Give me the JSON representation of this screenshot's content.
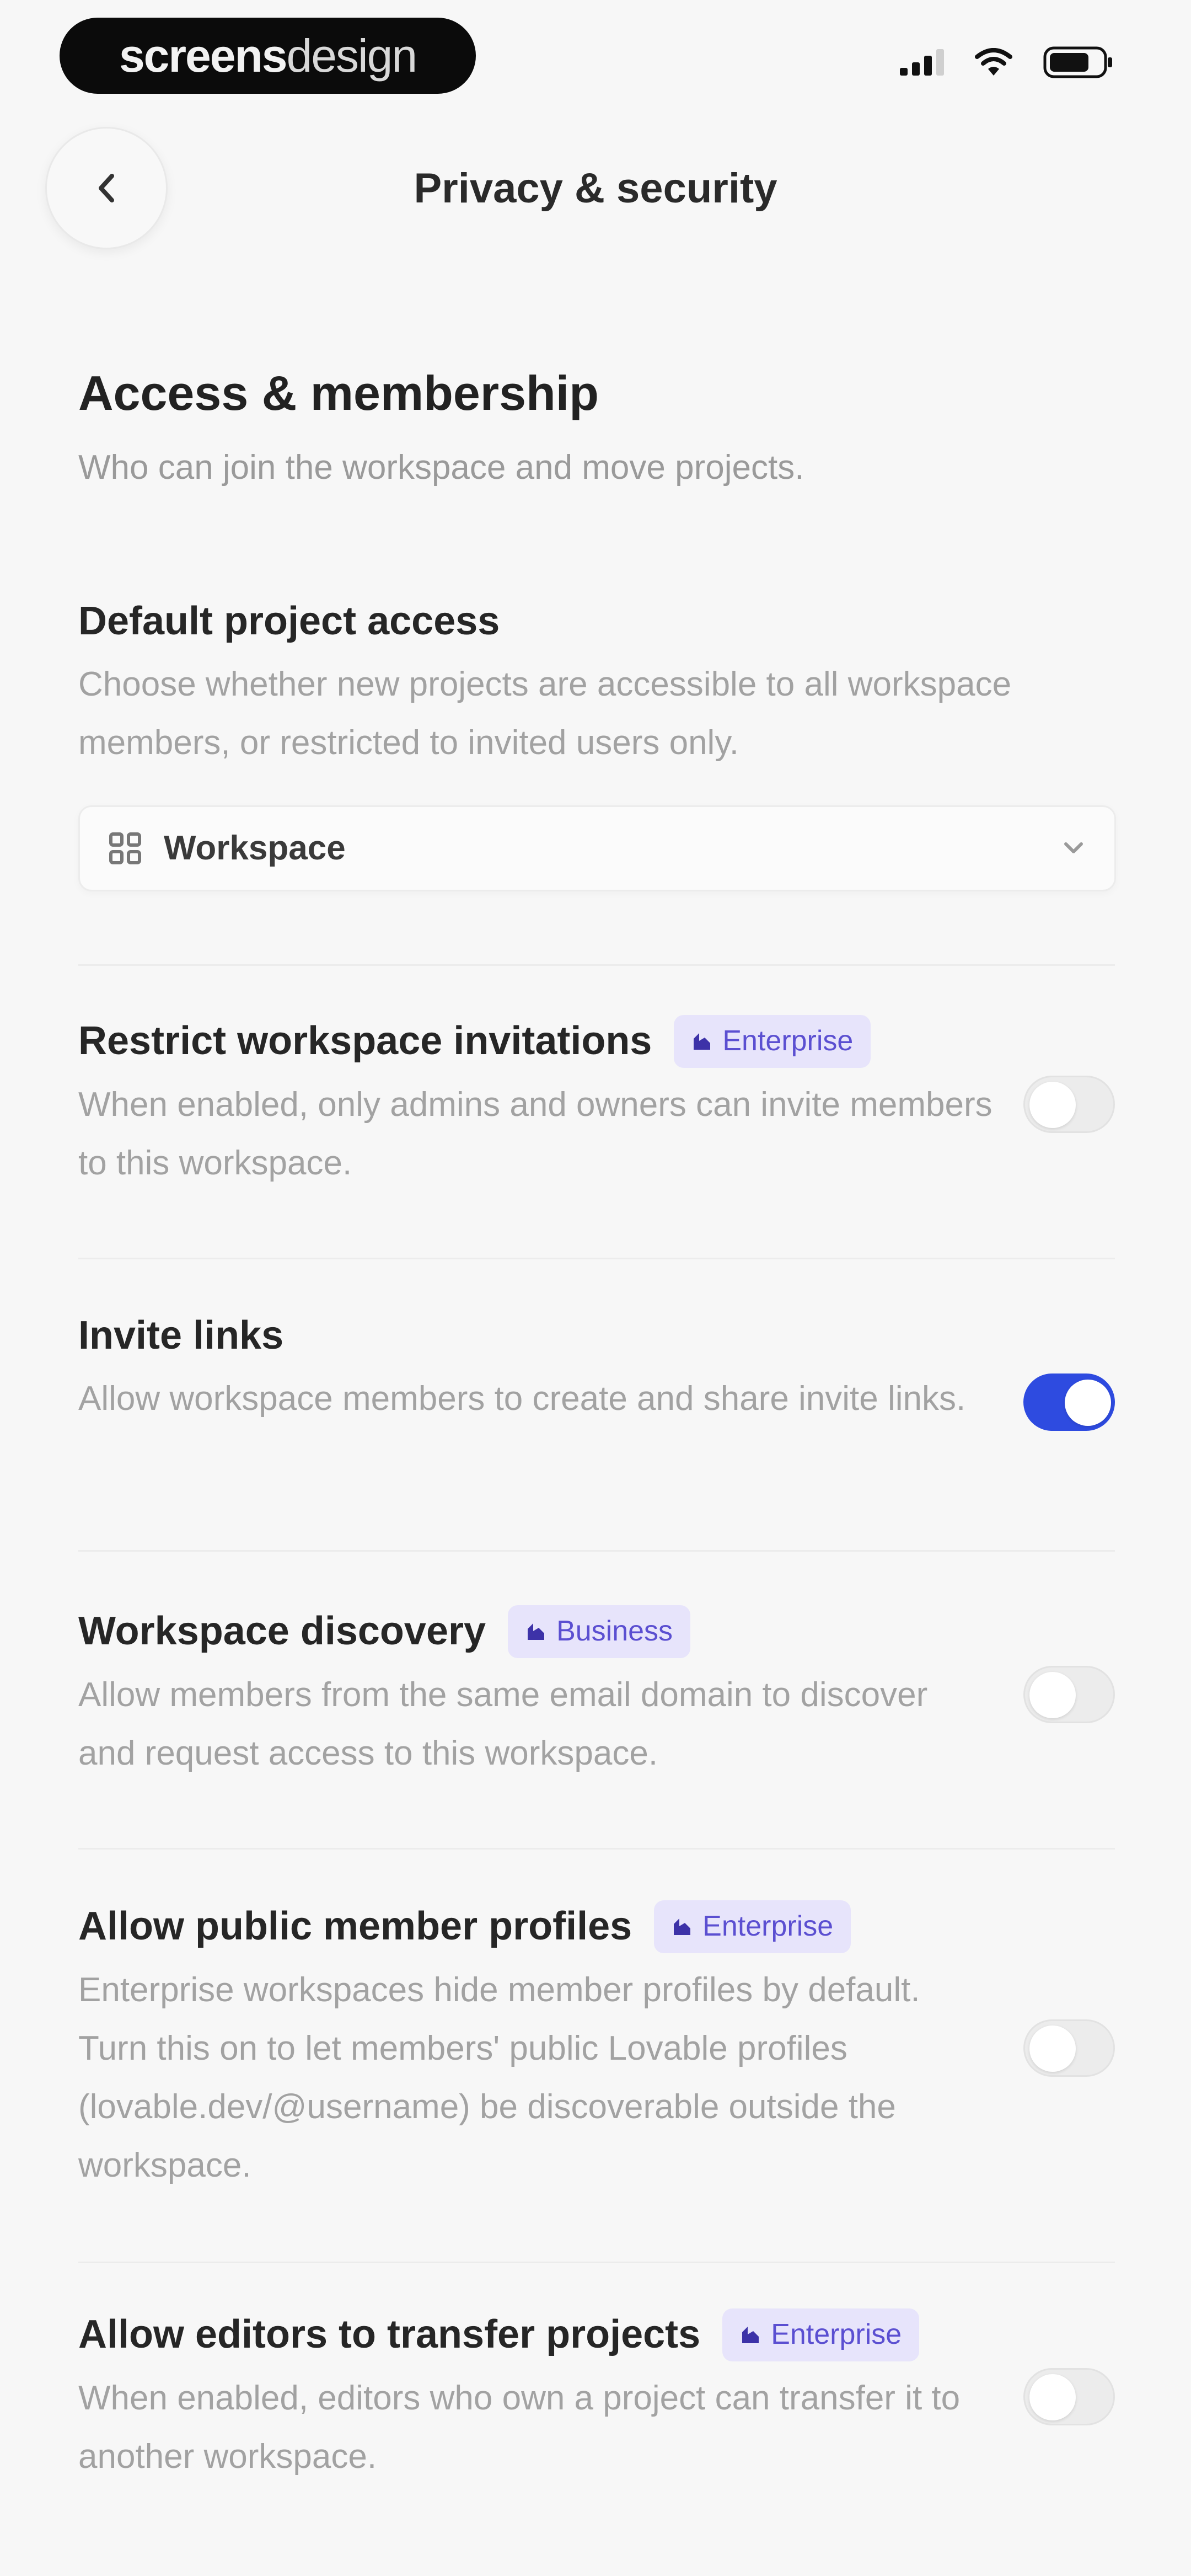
{
  "status_bar": {
    "brand_bold": "screens",
    "brand_light": "design"
  },
  "header": {
    "title": "Privacy & security",
    "back_icon": "chevron-left-icon"
  },
  "section": {
    "title": "Access & membership",
    "description": "Who can join the workspace and move projects."
  },
  "default_project_access": {
    "title": "Default project access",
    "description": "Choose whether new projects are accessible to all workspace members, or restricted to invited users only.",
    "selected_value": "Workspace",
    "icon": "grid-icon"
  },
  "settings": [
    {
      "title": "Restrict workspace invitations",
      "badge": "Enterprise",
      "description": "When enabled, only admins and owners can invite members to this workspace.",
      "enabled": false
    },
    {
      "title": "Invite links",
      "badge": "",
      "description": "Allow workspace members to create and share invite links.",
      "enabled": true
    },
    {
      "title": "Workspace discovery",
      "badge": "Business",
      "description": "Allow members from the same email domain to discover and request access to this workspace.",
      "enabled": false
    },
    {
      "title": "Allow public member profiles",
      "badge": "Enterprise",
      "description": "Enterprise workspaces hide member profiles by default. Turn this on to let members' public Lovable profiles (lovable.dev/@username) be discoverable outside the workspace.",
      "enabled": false
    },
    {
      "title": "Allow editors to transfer projects",
      "badge": "Enterprise",
      "description": "When enabled, editors who own a project can transfer it to another workspace.",
      "enabled": false
    }
  ],
  "colors": {
    "accent": "#2e4be0",
    "badge_bg": "#e7e4fb",
    "badge_text": "#5b4fd1"
  }
}
